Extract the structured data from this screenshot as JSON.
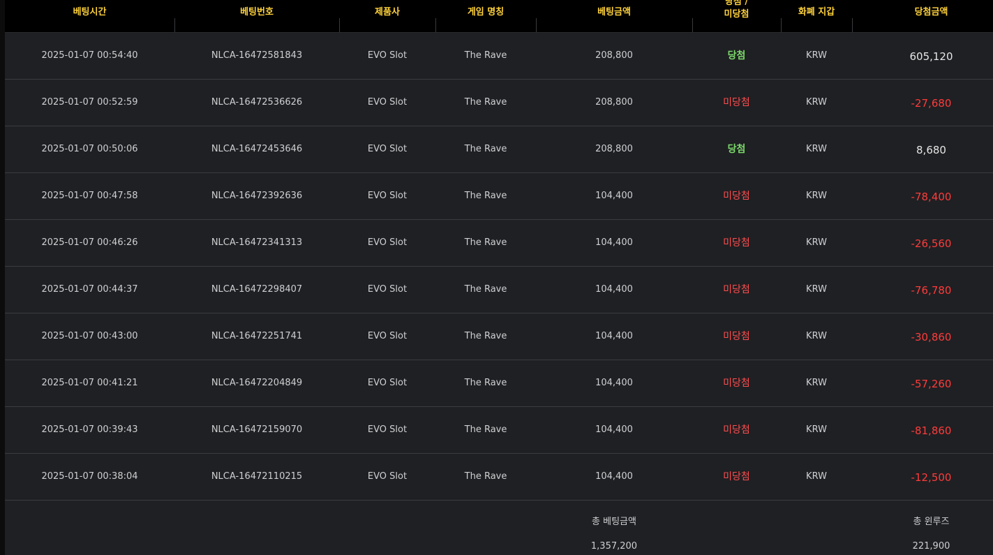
{
  "headers": {
    "bet_time": "베팅시간",
    "bet_number": "베팅번호",
    "provider": "제품사",
    "game_name": "게임 명칭",
    "bet_amount": "베팅금액",
    "result_line1": "당첨 /",
    "result_line2": "미당첨",
    "currency": "화폐 지갑",
    "win_amount": "당첨금액"
  },
  "rows": [
    {
      "time": "2025-01-07 00:54:40",
      "number": "NLCA-16472581843",
      "provider": "EVO Slot",
      "game": "The Rave",
      "bet": "208,800",
      "result": "당첨",
      "win": true,
      "currency": "KRW",
      "amount": "605,120"
    },
    {
      "time": "2025-01-07 00:52:59",
      "number": "NLCA-16472536626",
      "provider": "EVO Slot",
      "game": "The Rave",
      "bet": "208,800",
      "result": "미당첨",
      "win": false,
      "currency": "KRW",
      "amount": "-27,680"
    },
    {
      "time": "2025-01-07 00:50:06",
      "number": "NLCA-16472453646",
      "provider": "EVO Slot",
      "game": "The Rave",
      "bet": "208,800",
      "result": "당첨",
      "win": true,
      "currency": "KRW",
      "amount": "8,680"
    },
    {
      "time": "2025-01-07 00:47:58",
      "number": "NLCA-16472392636",
      "provider": "EVO Slot",
      "game": "The Rave",
      "bet": "104,400",
      "result": "미당첨",
      "win": false,
      "currency": "KRW",
      "amount": "-78,400"
    },
    {
      "time": "2025-01-07 00:46:26",
      "number": "NLCA-16472341313",
      "provider": "EVO Slot",
      "game": "The Rave",
      "bet": "104,400",
      "result": "미당첨",
      "win": false,
      "currency": "KRW",
      "amount": "-26,560"
    },
    {
      "time": "2025-01-07 00:44:37",
      "number": "NLCA-16472298407",
      "provider": "EVO Slot",
      "game": "The Rave",
      "bet": "104,400",
      "result": "미당첨",
      "win": false,
      "currency": "KRW",
      "amount": "-76,780"
    },
    {
      "time": "2025-01-07 00:43:00",
      "number": "NLCA-16472251741",
      "provider": "EVO Slot",
      "game": "The Rave",
      "bet": "104,400",
      "result": "미당첨",
      "win": false,
      "currency": "KRW",
      "amount": "-30,860"
    },
    {
      "time": "2025-01-07 00:41:21",
      "number": "NLCA-16472204849",
      "provider": "EVO Slot",
      "game": "The Rave",
      "bet": "104,400",
      "result": "미당첨",
      "win": false,
      "currency": "KRW",
      "amount": "-57,260"
    },
    {
      "time": "2025-01-07 00:39:43",
      "number": "NLCA-16472159070",
      "provider": "EVO Slot",
      "game": "The Rave",
      "bet": "104,400",
      "result": "미당첨",
      "win": false,
      "currency": "KRW",
      "amount": "-81,860"
    },
    {
      "time": "2025-01-07 00:38:04",
      "number": "NLCA-16472110215",
      "provider": "EVO Slot",
      "game": "The Rave",
      "bet": "104,400",
      "result": "미당첨",
      "win": false,
      "currency": "KRW",
      "amount": "-12,500"
    }
  ],
  "footer": {
    "total_bet_label": "총 베팅금액",
    "total_bet_value": "1,357,200",
    "total_rolling_label": "총 윈루즈",
    "total_rolling_value": "221,900"
  },
  "colors": {
    "header_text": "#ffd23b",
    "win": "#7bd96b",
    "lose": "#ff4d4f",
    "negative_amount": "#ff3b3b",
    "row_bg": "#1f2023"
  }
}
